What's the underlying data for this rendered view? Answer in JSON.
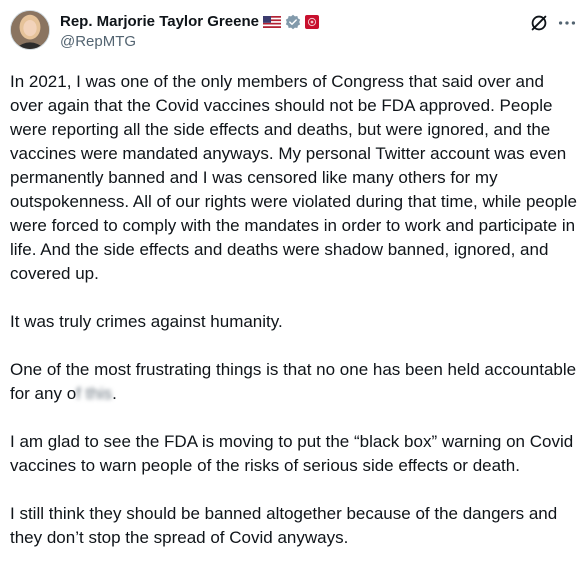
{
  "author": {
    "name": "Rep. Marjorie Taylor Greene",
    "handle": "@RepMTG",
    "badges": [
      "us-flag-icon",
      "verified-gray-badge-icon",
      "government-seal-icon"
    ]
  },
  "header_actions": {
    "grok_icon": "grok-icon",
    "more_icon": "more-icon"
  },
  "tweet": {
    "paragraphs": [
      "In 2021, I was one of the only members of Congress that said over and over again that the Covid vaccines should not be FDA approved. People were reporting all the side effects and deaths, but were ignored, and the vaccines were mandated anyways. My personal Twitter account was even permanently banned and I was censored like many others for my outspokenness. All of our rights were violated during that time, while people were forced to comply with the mandates in order to work and participate in life. And the side effects and deaths were shadow banned, ignored, and covered up.",
      "It was truly crimes against humanity.",
      "One of the most frustrating things is that no one has been held accountable for any o",
      "I  am glad to see the FDA is moving to put the “black box” warning on Covid vaccines to warn people of the risks of serious side effects or death.",
      "I still think they should be banned altogether because of the dangers and they don’t stop the spread of Covid anyways."
    ],
    "blurred_fragment": "f this",
    "fragment_end": "."
  },
  "colors": {
    "text": "#0f1419",
    "secondary": "#536471",
    "verified_badge": "#829aab",
    "seal": "#c8102e"
  }
}
